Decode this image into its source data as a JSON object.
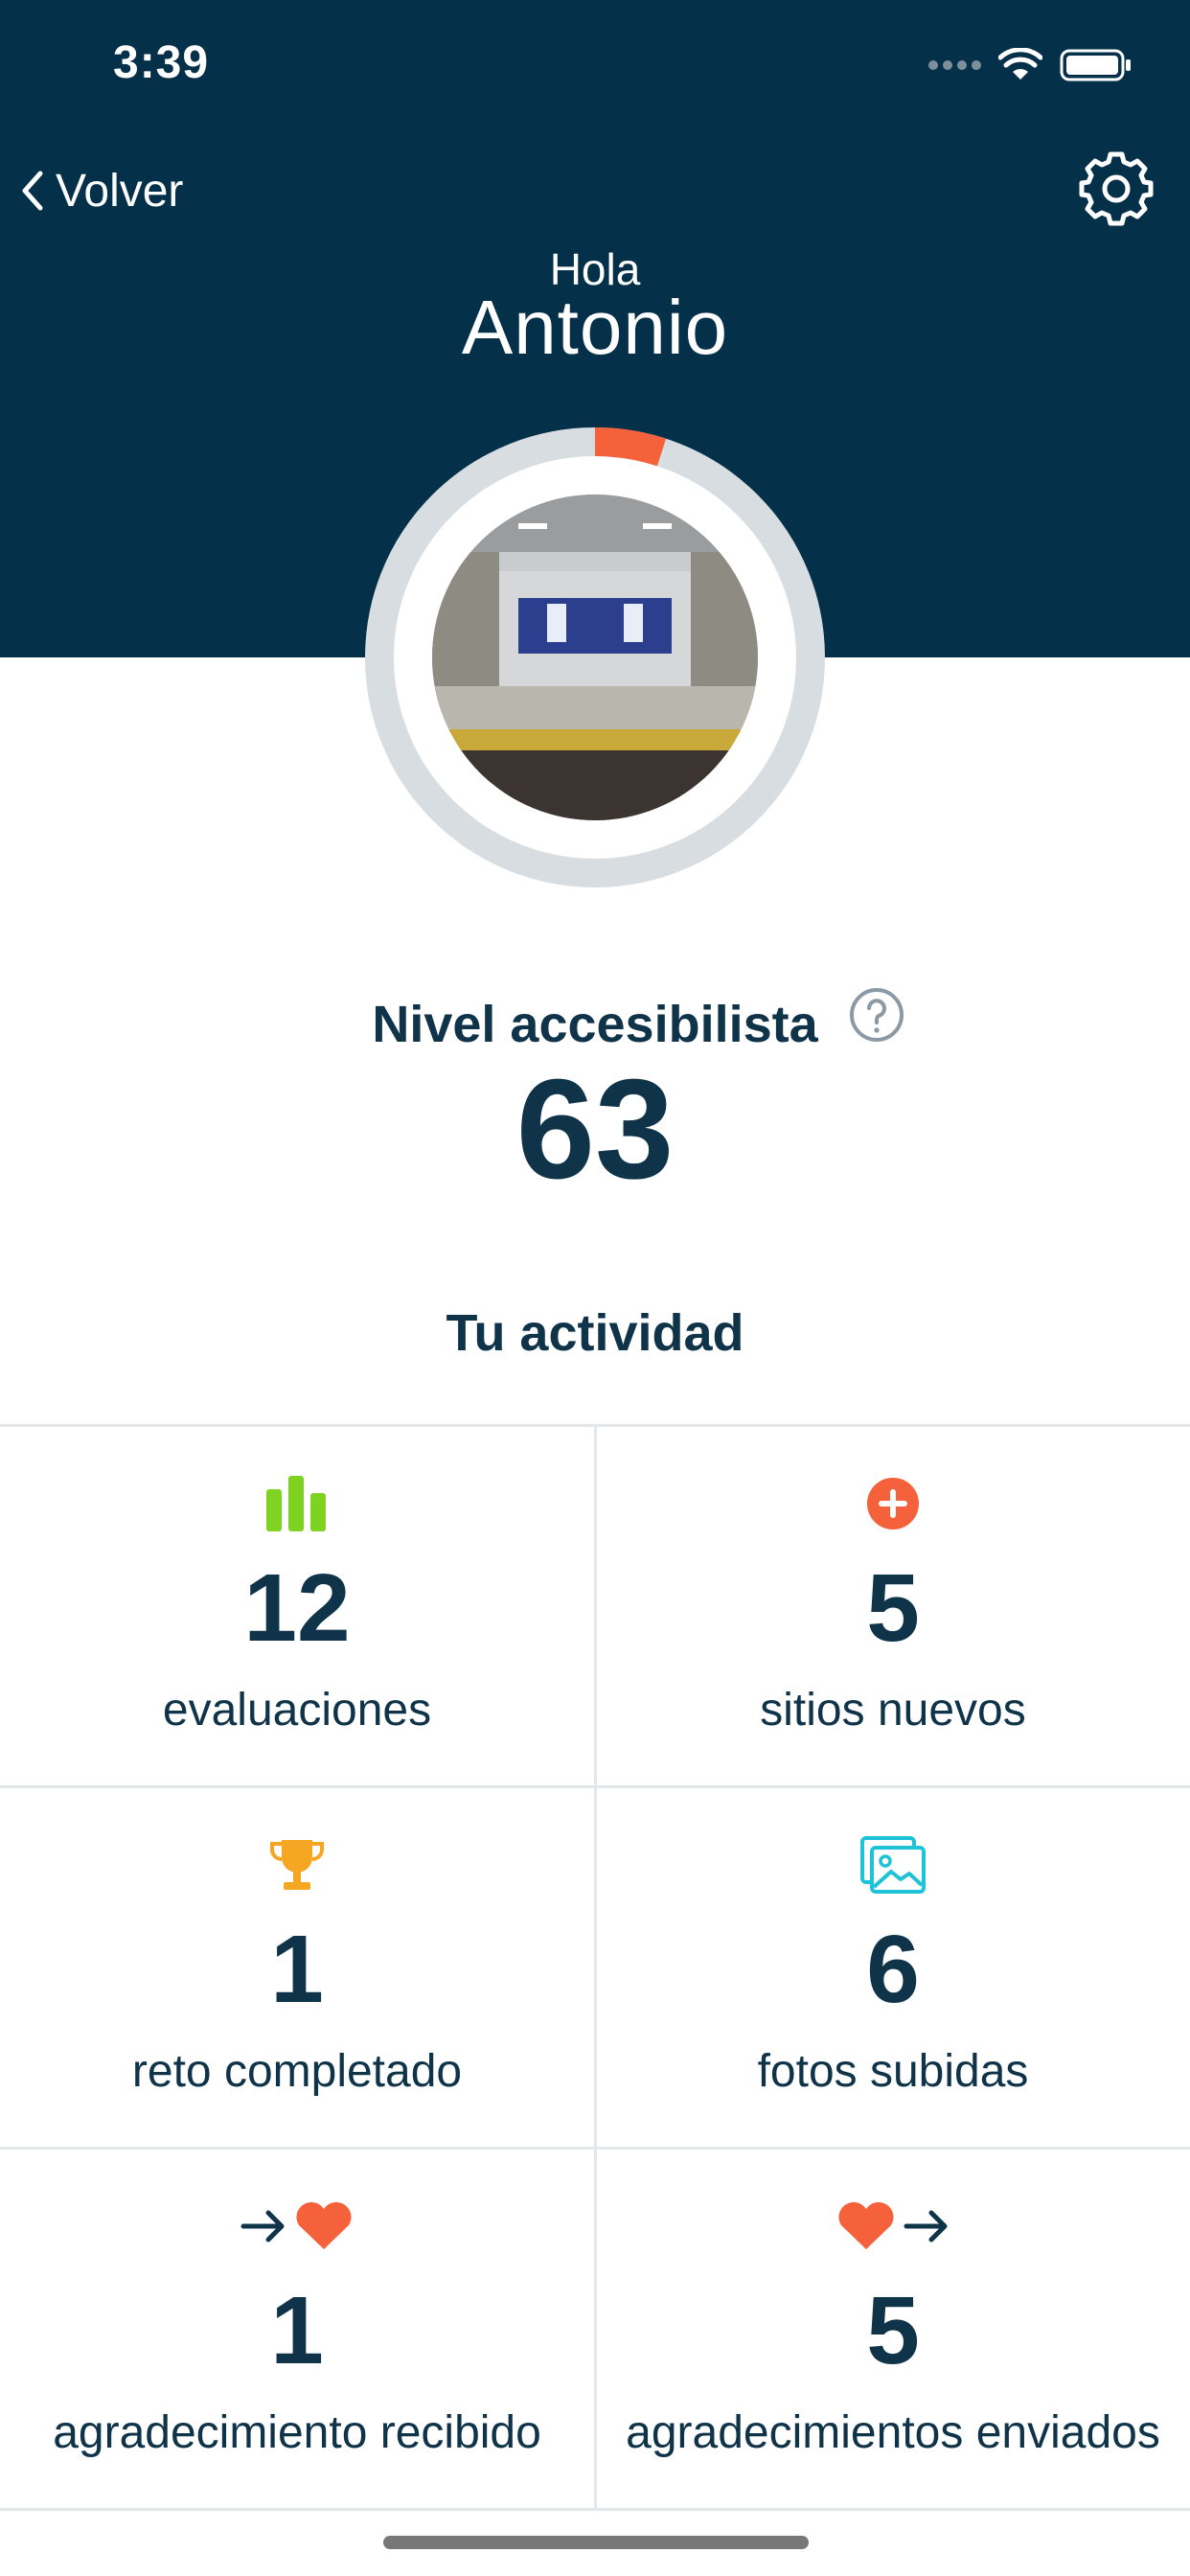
{
  "status_bar": {
    "time": "3:39"
  },
  "nav": {
    "back_label": "Volver"
  },
  "header": {
    "greeting": "Hola",
    "name": "Antonio"
  },
  "level": {
    "label": "Nivel accesibilista",
    "value": "63",
    "progress": 0.05
  },
  "activity": {
    "title": "Tu actividad",
    "items": [
      {
        "value": "12",
        "label": "evaluaciones",
        "icon": "bar-chart-icon"
      },
      {
        "value": "5",
        "label": "sitios nuevos",
        "icon": "plus-circle-icon"
      },
      {
        "value": "1",
        "label": "reto completado",
        "icon": "trophy-icon"
      },
      {
        "value": "6",
        "label": "fotos subidas",
        "icon": "photos-icon"
      },
      {
        "value": "1",
        "label": "agradecimiento recibido",
        "icon": "heart-received-icon"
      },
      {
        "value": "5",
        "label": "agradecimientos enviados",
        "icon": "heart-sent-icon"
      }
    ]
  },
  "colors": {
    "header_bg": "#053049",
    "accent_orange": "#f4613a",
    "green": "#7ed321",
    "trophy": "#f5a623",
    "cyan": "#1ec3d8",
    "ring_track": "#d7dde1"
  }
}
